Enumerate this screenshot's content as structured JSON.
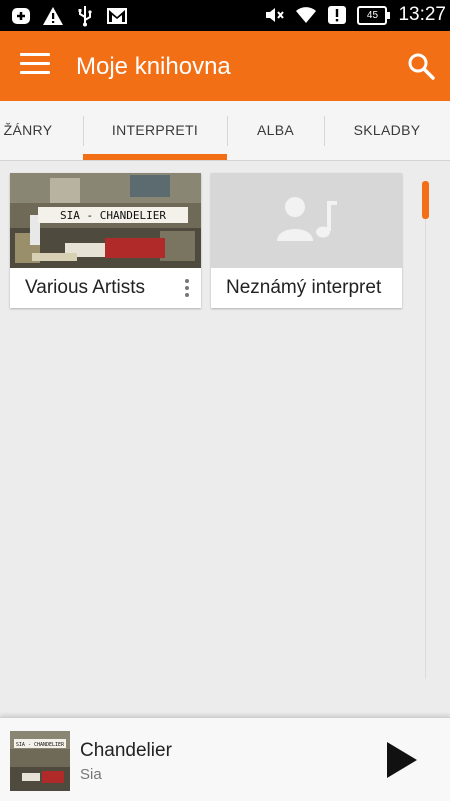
{
  "status_bar": {
    "icons_left": [
      "add-box-icon",
      "warning-icon",
      "usb-icon",
      "gmail-icon"
    ],
    "icons_right": [
      "mute-icon",
      "wifi-icon",
      "alert-box-icon"
    ],
    "battery": "45",
    "time": "13:27"
  },
  "app_bar": {
    "title": "Moje knihovna",
    "menu_icon": "hamburger-menu-icon",
    "search_icon": "search-icon",
    "color": "#f36f16"
  },
  "tabs": [
    {
      "label": "ŽÁNRY",
      "active": false
    },
    {
      "label": "INTERPRETI",
      "active": true
    },
    {
      "label": "ALBA",
      "active": false
    },
    {
      "label": "SKLADBY",
      "active": false
    }
  ],
  "artists": [
    {
      "name": "Various Artists",
      "art_text": "SIA - CHANDELIER",
      "has_menu": true
    },
    {
      "name": "Neznámý interpret",
      "art_icon": "artist-music-placeholder-icon",
      "has_menu": false
    }
  ],
  "now_playing": {
    "title": "Chandelier",
    "artist": "Sia",
    "art_text": "SIA - CHANDELIER",
    "play_icon": "play-icon"
  }
}
